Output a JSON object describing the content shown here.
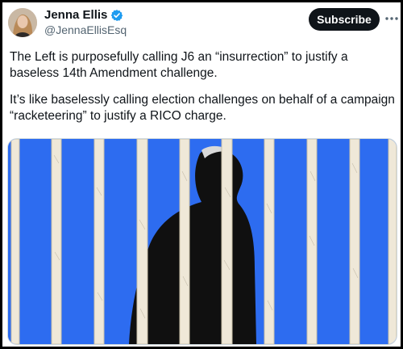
{
  "author": {
    "display_name": "Jenna Ellis",
    "handle": "@JennaEllisEsq",
    "verified": true,
    "avatar_icon": "avatar-photo"
  },
  "actions": {
    "subscribe_label": "Subscribe",
    "more_icon": "more-horizontal-icon"
  },
  "post": {
    "paragraph_1": "The Left is purposefully calling J6 an “insurrection” to justify a baseless 14th Amendment challenge.",
    "paragraph_2": "It’s like baselessly calling election challenges on behalf of a campaign “racketeering” to justify a RICO charge."
  },
  "media": {
    "description": "image-bars-silhouette",
    "colors": {
      "background": "#2d6cf0",
      "bars": "#efe8d8",
      "silhouette": "#101010"
    }
  },
  "colors": {
    "text_primary": "#0f1419",
    "text_secondary": "#536471",
    "verified_blue": "#1d9bf0",
    "button_bg": "#0f1419"
  }
}
